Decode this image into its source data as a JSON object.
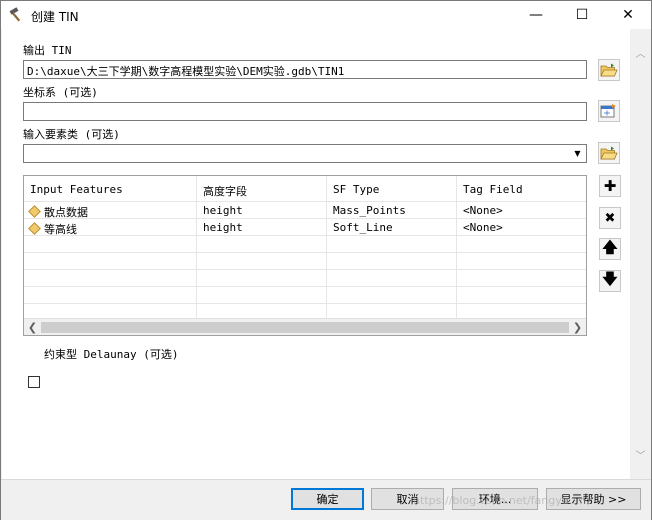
{
  "window": {
    "title": "创建 TIN",
    "minimize_glyph": "—",
    "maximize_glyph": "☐",
    "close_glyph": "✕"
  },
  "output_tin": {
    "label": "输出 TIN",
    "value": "D:\\daxue\\大三下学期\\数字高程模型实验\\DEM实验.gdb\\TIN1",
    "browse_icon": "folder-open-icon"
  },
  "coordinate_system": {
    "label": "坐标系 (可选)",
    "value": "",
    "icon": "spatial-reference-icon"
  },
  "input_features": {
    "label": "输入要素类 (可选)",
    "value": "",
    "browse_icon": "folder-open-icon"
  },
  "table": {
    "columns": [
      "Input Features",
      "高度字段",
      "SF Type",
      "Tag Field"
    ],
    "rows": [
      {
        "input_features": "散点数据",
        "height_field": "height",
        "sf_type": "Mass_Points",
        "tag_field": "<None>"
      },
      {
        "input_features": "等高线",
        "height_field": "height",
        "sf_type": "Soft_Line",
        "tag_field": "<None>"
      }
    ],
    "side_buttons": [
      "add-icon",
      "remove-icon",
      "move-up-icon",
      "move-down-icon"
    ]
  },
  "delaunay": {
    "label": "约束型 Delaunay (可选)",
    "checked": false
  },
  "buttons": {
    "ok": "确定",
    "cancel": "取消",
    "environments": "环境...",
    "show_help": "显示帮助 >>"
  },
  "watermark": "https://blog.csdn.net/fangyu...nx"
}
